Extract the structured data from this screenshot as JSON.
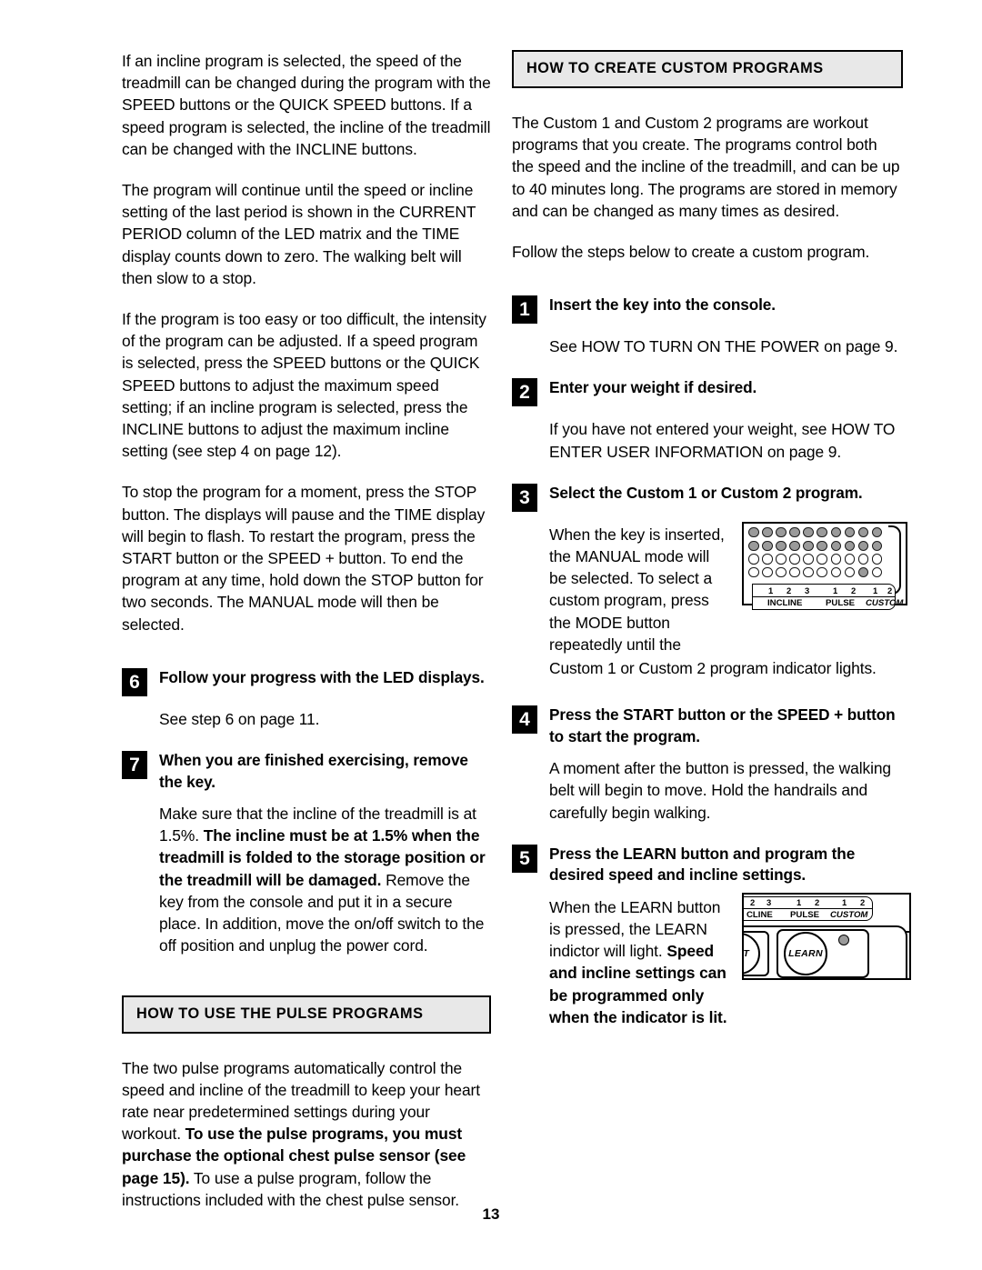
{
  "document": {
    "page_number": "13"
  },
  "left_column": {
    "paragraphs": [
      "If an incline program is selected, the speed of the treadmill can be changed during the program with the SPEED buttons or the QUICK SPEED buttons. If a speed program is selected, the incline of the treadmill can be changed with the INCLINE buttons.",
      "The program will continue until the speed or incline setting of the last period is shown in the CURRENT PERIOD column of the LED matrix and the TIME display counts down to zero. The walking belt will then slow to a stop.",
      "If the program is too easy or too difficult, the intensity of the program can be adjusted. If a speed program is selected, press the SPEED buttons or the QUICK SPEED buttons to adjust the maximum speed setting; if an incline program is selected, press the INCLINE buttons to adjust the maximum incline setting (see step 4 on page 12).",
      "To stop the program for a moment, press the STOP button. The displays will pause and the TIME display will begin to flash. To restart the program, press the START button or the SPEED + button. To end the program at any time, hold down the STOP button for two seconds. The MANUAL mode will then be selected."
    ],
    "step6": {
      "number": "6",
      "title": "Follow your progress with the LED displays.",
      "body": "See step 6 on page 11."
    },
    "step7": {
      "number": "7",
      "title": "When you are finished exercising, remove the key.",
      "body_1": "Make sure that the incline of the treadmill is at 1.5%. ",
      "body_bold": "The incline must be at 1.5% when the treadmill is folded to the storage position or the treadmill will be damaged.",
      "body_2": " Remove the key from the console and put it in a secure place. In addition, move the on/off switch to the off position and unplug the power cord."
    },
    "pulse_section": {
      "heading": "HOW TO USE THE PULSE PROGRAMS",
      "body_1": "The two pulse programs automatically control the speed and incline of the treadmill to keep your heart rate near predetermined settings during your workout. ",
      "body_bold": "To use the pulse programs, you must purchase the optional chest pulse sensor (see page 15).",
      "body_2": " To use a pulse program, follow the instructions included with the chest pulse sensor."
    }
  },
  "right_column": {
    "heading": "HOW TO CREATE CUSTOM PROGRAMS",
    "intro_paragraphs": [
      "The Custom 1 and Custom 2 programs are workout programs that you create. The programs control both the speed and the incline of the treadmill, and can be up to 40 minutes long. The programs are stored in memory and can be changed as many times as desired.",
      "Follow the steps below to create a custom program."
    ],
    "step1": {
      "number": "1",
      "title": "Insert the key into the console.",
      "body": "See HOW TO TURN ON THE POWER on page 9."
    },
    "step2": {
      "number": "2",
      "title": "Enter your weight if desired.",
      "body": "If you have not entered your weight, see HOW TO ENTER USER INFORMATION on page 9."
    },
    "step3": {
      "number": "3",
      "title": "Select the Custom 1 or Custom 2 program.",
      "body_narrow": "When the key is inserted, the MANUAL mode will be selected. To select a custom program, press the MODE button repeatedly until the",
      "body_wide": "Custom 1 or Custom 2 program indicator lights."
    },
    "step4": {
      "number": "4",
      "title": "Press the START button or the SPEED + button to start the program.",
      "body": "A moment after the button is pressed, the walking belt will begin to move. Hold the handrails and carefully begin walking."
    },
    "step5": {
      "number": "5",
      "title": "Press the LEARN button and program the desired speed and incline settings.",
      "body_1": "When the LEARN button is pressed, the LEARN indictor will light. ",
      "body_bold": "Speed and incline settings can be programmed only when the indicator is lit."
    },
    "figures": {
      "led_matrix": {
        "rows": [
          [
            1,
            1,
            1,
            1,
            1,
            1,
            1,
            1,
            1,
            1
          ],
          [
            1,
            1,
            1,
            1,
            1,
            1,
            1,
            1,
            1,
            1
          ],
          [
            0,
            0,
            0,
            0,
            0,
            0,
            0,
            0,
            0,
            0
          ],
          [
            0,
            0,
            0,
            0,
            0,
            0,
            0,
            0,
            1,
            0
          ]
        ],
        "number_labels": [
          "1",
          "2",
          "3",
          "1",
          "2",
          "1",
          "2"
        ],
        "group_labels": [
          "INCLINE",
          "PULSE",
          "CUSTOM"
        ],
        "on_color": "#9a9a9a",
        "off_color": "#ffffff"
      },
      "learn_console": {
        "number_labels": [
          "2",
          "3",
          "1",
          "2",
          "1",
          "2"
        ],
        "group_labels": [
          "CLINE",
          "PULSE",
          "CUSTOM"
        ],
        "start_button_label": "ART",
        "learn_button_label": "LEARN",
        "indicator_color": "#9a9a9a"
      }
    }
  }
}
